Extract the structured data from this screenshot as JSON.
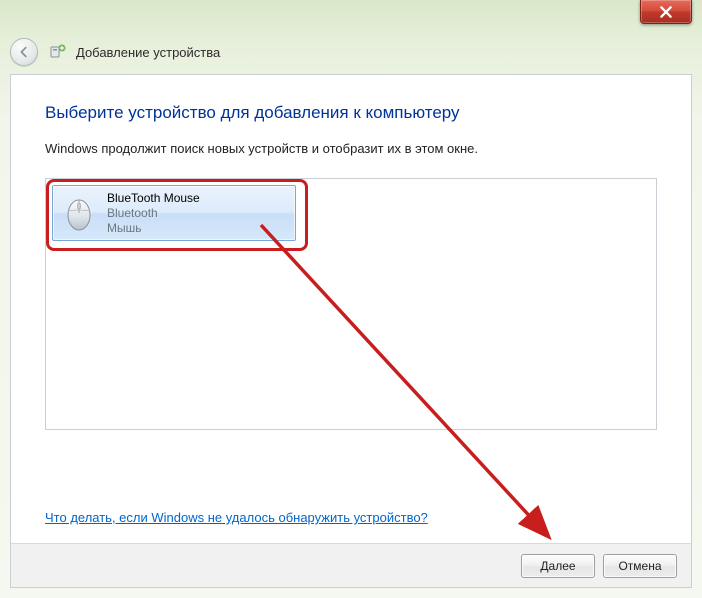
{
  "window": {
    "title": "Добавление устройства"
  },
  "main": {
    "heading": "Выберите устройство для добавления к компьютеру",
    "subtext": "Windows продолжит поиск новых устройств и отобразит их в этом окне.",
    "help_link": "Что делать, если Windows не удалось обнаружить устройство?"
  },
  "device": {
    "name": "BlueTooth Mouse",
    "transport": "Bluetooth",
    "type": "Мышь"
  },
  "footer": {
    "next": "Далее",
    "cancel": "Отмена"
  }
}
